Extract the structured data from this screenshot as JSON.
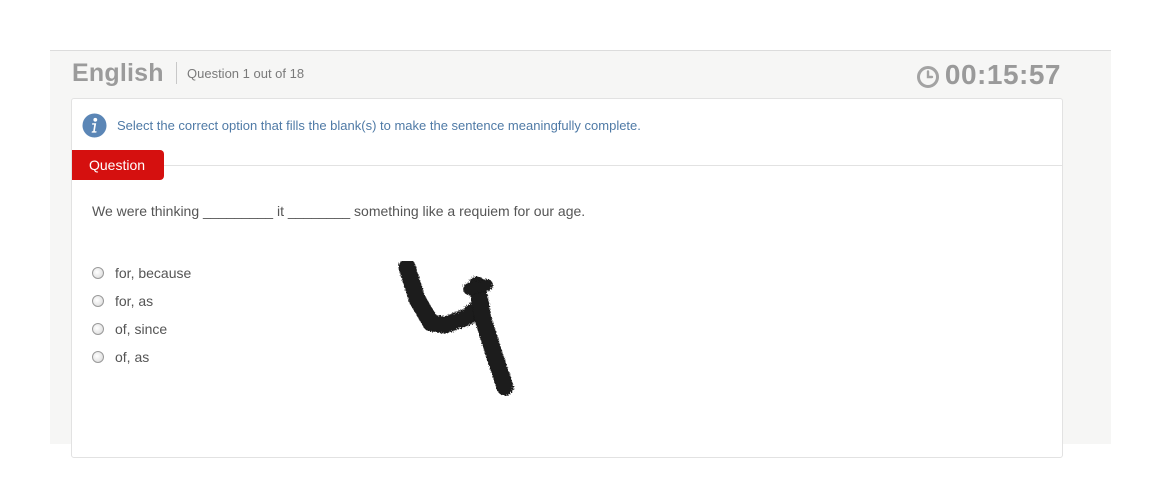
{
  "header": {
    "subject": "English",
    "question_counter": "Question 1 out of 18",
    "timer": "00:15:57",
    "timer_icon": "clock-icon"
  },
  "instruction": {
    "icon": "info-icon",
    "text": "Select the correct option that fills the blank(s) to make the sentence meaningfully complete."
  },
  "question_tab": {
    "label": "Question"
  },
  "question": {
    "text": "We were thinking _________ it ________ something like a requiem for our age.",
    "options": [
      {
        "label": "for, because",
        "selected": false
      },
      {
        "label": "for, as",
        "selected": false
      },
      {
        "label": "of, since",
        "selected": false
      },
      {
        "label": "of, as",
        "selected": false
      }
    ]
  },
  "colors": {
    "accent_red": "#d5100f",
    "info_blue": "#4f7aa6",
    "heading_gray": "#9b9b9b"
  }
}
